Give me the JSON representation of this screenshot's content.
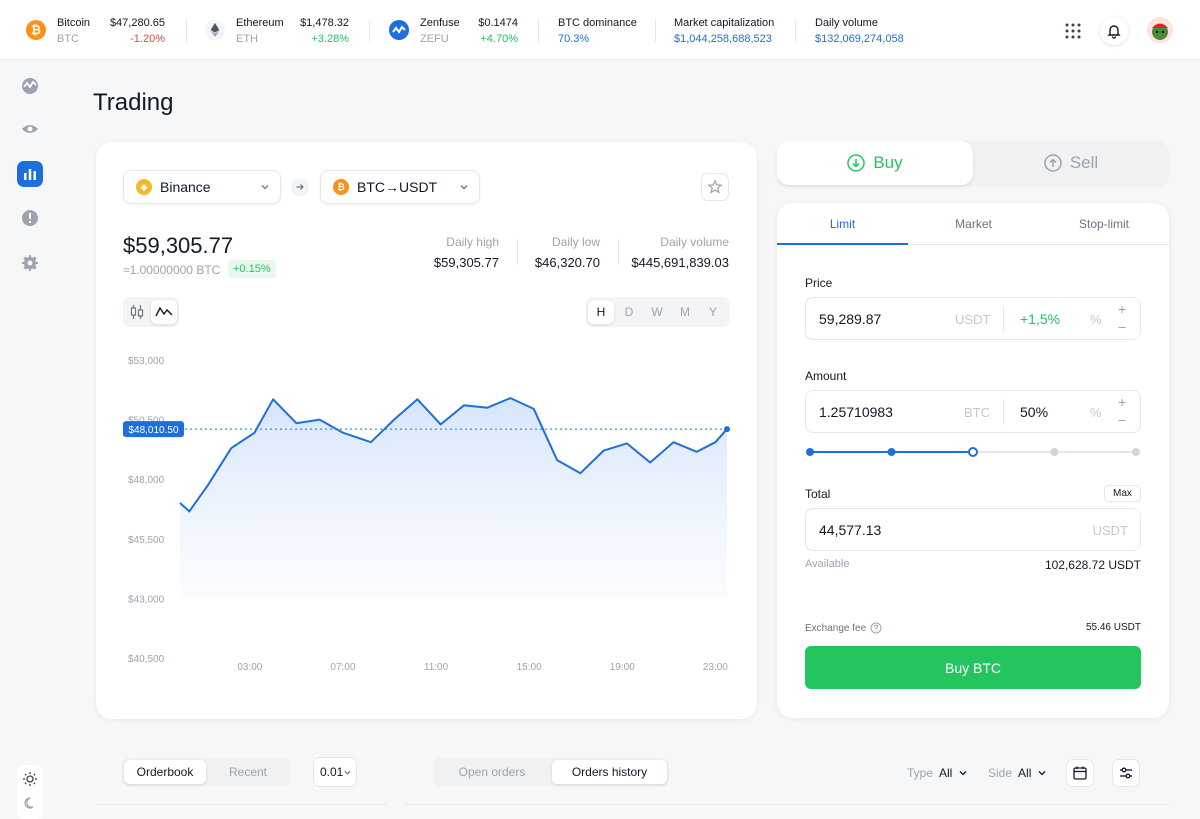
{
  "ticker": [
    {
      "name": "Bitcoin",
      "symbol": "BTC",
      "price": "$47,280.65",
      "change": "-1.20%",
      "icon": "bitcoin-icon",
      "color": "#f7931a"
    },
    {
      "name": "Ethereum",
      "symbol": "ETH",
      "price": "$1,478.32",
      "change": "+3.28%",
      "icon": "ethereum-icon",
      "color": "#6b7280"
    },
    {
      "name": "Zenfuse",
      "symbol": "ZEFU",
      "price": "$0.1474",
      "change": "+4.70%",
      "icon": "zenfuse-icon",
      "color": "#1d6fdc"
    }
  ],
  "stats": [
    {
      "label": "BTC dominance",
      "value": "70.3%"
    },
    {
      "label": "Market capitalization",
      "value": "$1,044,258,688,523"
    },
    {
      "label": "Daily volume",
      "value": "$132,069,274,058"
    }
  ],
  "page_title": "Trading",
  "exchange_select": "Binance",
  "pair_select": "BTC→USDT",
  "price": {
    "main": "$59,305.77",
    "btc": "≈1.00000000 BTC",
    "change": "+0.15%"
  },
  "daily": [
    {
      "label": "Daily high",
      "value": "$59,305.77"
    },
    {
      "label": "Daily low",
      "value": "$46,320.70"
    },
    {
      "label": "Daily volume",
      "value": "$445,691,839.03"
    }
  ],
  "timeframes": [
    "H",
    "D",
    "W",
    "M",
    "Y"
  ],
  "active_timeframe": "H",
  "chart_data": {
    "type": "area",
    "x_ticks": [
      "03:00",
      "07:00",
      "11:00",
      "15:00",
      "19:00",
      "23:00"
    ],
    "y_ticks": [
      "$53,000",
      "$50,500",
      "$48,000",
      "$45,500",
      "$43,000",
      "$40,500"
    ],
    "ylim": [
      40500,
      53000
    ],
    "x_range": [
      0,
      23.5
    ],
    "points": [
      [
        0,
        47000
      ],
      [
        0.4,
        46650
      ],
      [
        1.2,
        47750
      ],
      [
        2.2,
        49300
      ],
      [
        3.2,
        49950
      ],
      [
        4.0,
        51350
      ],
      [
        5.0,
        50350
      ],
      [
        6.0,
        50500
      ],
      [
        7.0,
        49950
      ],
      [
        8.2,
        49550
      ],
      [
        9.2,
        50500
      ],
      [
        10.2,
        51350
      ],
      [
        11.2,
        50300
      ],
      [
        12.2,
        51100
      ],
      [
        13.2,
        51000
      ],
      [
        14.2,
        51400
      ],
      [
        15.2,
        50950
      ],
      [
        16.2,
        48800
      ],
      [
        17.2,
        48250
      ],
      [
        18.2,
        49200
      ],
      [
        19.2,
        49500
      ],
      [
        20.2,
        48700
      ],
      [
        21.2,
        49550
      ],
      [
        22.2,
        49150
      ],
      [
        23.0,
        49550
      ],
      [
        23.5,
        50100
      ]
    ],
    "current_label": "$48,010.50",
    "current_value": 50100
  },
  "order": {
    "buy_label": "Buy",
    "sell_label": "Sell",
    "tabs": [
      "Limit",
      "Market",
      "Stop-limit"
    ],
    "active_tab": "Limit",
    "price_label": "Price",
    "price_value": "59,289.87",
    "price_unit": "USDT",
    "price_pct": "+1,5%",
    "pct_sign": "%",
    "amount_label": "Amount",
    "amount_value": "1.25710983",
    "amount_unit": "BTC",
    "amount_pct": "50%",
    "slider_value": 0.5,
    "total_label": "Total",
    "max_label": "Max",
    "total_value": "44,577.13",
    "total_unit": "USDT",
    "available_label": "Available",
    "available_value": "102,628.72 USDT",
    "fee_label": "Exchange fee",
    "fee_value": "55.46 USDT",
    "submit_label": "Buy BTC",
    "plus": "+",
    "minus": "−"
  },
  "bottom": {
    "book_tabs": [
      "Orderbook",
      "Recent"
    ],
    "book_active": "Orderbook",
    "precision": "0.01",
    "order_tabs": [
      "Open orders",
      "Orders history"
    ],
    "order_active": "Orders history",
    "type_label": "Type",
    "type_value": "All",
    "side_label": "Side",
    "side_value": "All"
  },
  "colors": {
    "accent": "#1d6fdc",
    "buy": "#22c55e",
    "sell": "#ef4444"
  }
}
